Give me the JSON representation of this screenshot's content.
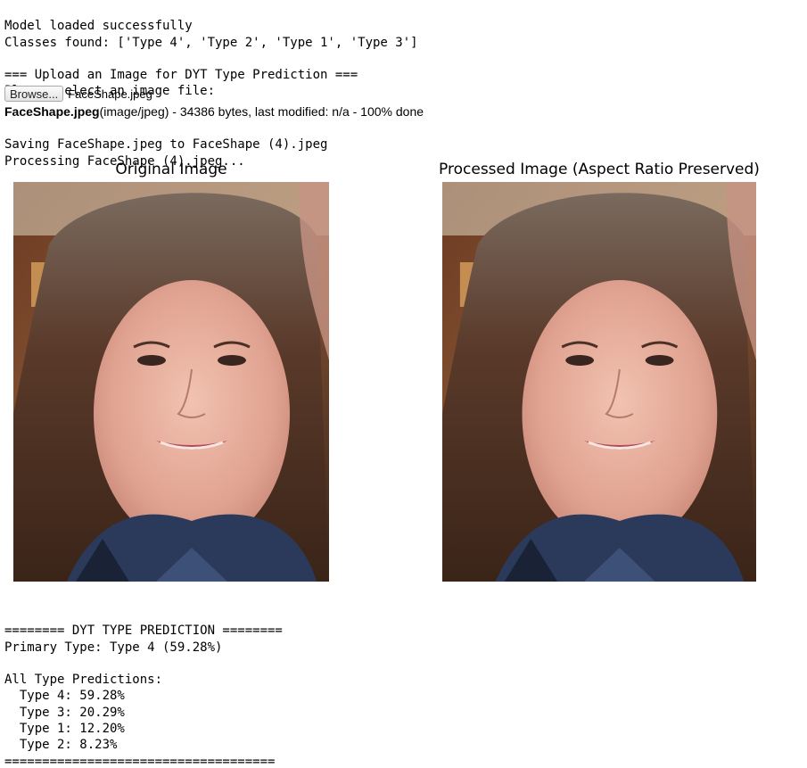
{
  "log_top": [
    "Model loaded successfully",
    "Classes found: ['Type 4', 'Type 2', 'Type 1', 'Type 3']",
    "",
    "=== Upload an Image for DYT Type Prediction ===",
    "Please select an image file:"
  ],
  "upload_widget": {
    "browse_label": "Browse...",
    "selected_file": "FaceShape.jpeg"
  },
  "upload_status": {
    "file_bold": "FaceShape.jpeg",
    "details": "(image/jpeg) - 34386 bytes, last modified: n/a - 100% done"
  },
  "log_saving": [
    "Saving FaceShape.jpeg to FaceShape (4).jpeg",
    "Processing FaceShape (4).jpeg..."
  ],
  "figures": {
    "original_title": "Original Image",
    "processed_title": "Processed Image (Aspect Ratio Preserved)"
  },
  "result": {
    "header": "======== DYT TYPE PREDICTION ========",
    "primary": "Primary Type: Type 4 (59.28%)",
    "all_heading": "All Type Predictions:",
    "predictions": [
      "  Type 4: 59.28%",
      "  Type 3: 20.29%",
      "  Type 1: 12.20%",
      "  Type 2: 8.23%"
    ],
    "footer": "===================================="
  }
}
